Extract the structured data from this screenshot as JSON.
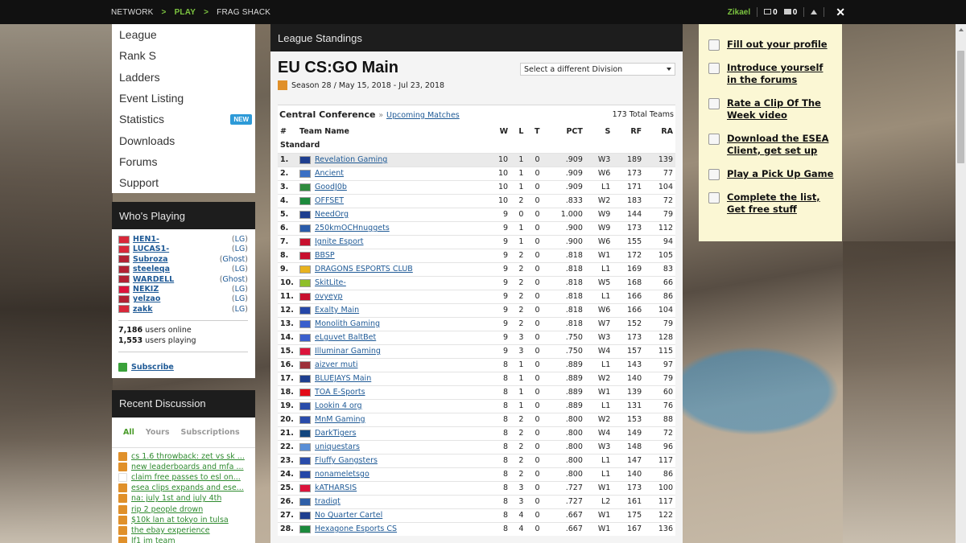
{
  "topbar": {
    "crumbs": [
      "NETWORK",
      "PLAY",
      "FRAG SHACK"
    ],
    "sep": ">",
    "user": "Zikael",
    "mail_count": "0",
    "chat_count": "0",
    "close_symbol": "✕"
  },
  "nav": {
    "items": [
      "League",
      "Rank S",
      "Ladders",
      "Event Listing",
      "Statistics",
      "Downloads",
      "Forums",
      "Support"
    ],
    "new_badge": "NEW"
  },
  "whos_playing": {
    "title": "Who's Playing",
    "players": [
      {
        "name": "HEN1-",
        "game": "LG",
        "flag": "#d8283a"
      },
      {
        "name": "LUCAS1-",
        "game": "LG",
        "flag": "#d8283a"
      },
      {
        "name": "Subroza",
        "game": "Ghost",
        "flag": "#b22234"
      },
      {
        "name": "steeleqa",
        "game": "LG",
        "flag": "#b22234"
      },
      {
        "name": "WARDELL",
        "game": "Ghost",
        "flag": "#b22234"
      },
      {
        "name": "NEKIZ",
        "game": "LG",
        "flag": "#dc143c"
      },
      {
        "name": "yelzao",
        "game": "LG",
        "flag": "#b22234"
      },
      {
        "name": "zakk",
        "game": "LG",
        "flag": "#d8283a"
      }
    ],
    "users_online": "7,186",
    "users_online_label": "users online",
    "users_playing": "1,553",
    "users_playing_label": "users playing",
    "subscribe": "Subscribe"
  },
  "recent": {
    "title": "Recent Discussion",
    "tabs": [
      "All",
      "Yours",
      "Subscriptions"
    ],
    "items": [
      {
        "text": "cs 1.6 throwback: zet vs sk ...",
        "icon": "cs"
      },
      {
        "text": "new leaderboards and mfa ...",
        "icon": "cs"
      },
      {
        "text": "claim free passes to esl on...",
        "icon": "blank"
      },
      {
        "text": "esea clips expands and ese...",
        "icon": "cs"
      },
      {
        "text": "na: july 1st and july 4th",
        "icon": "cs"
      },
      {
        "text": "rip 2 people drown",
        "icon": "cs"
      },
      {
        "text": "$10k lan at tokyo in tulsa",
        "icon": "cs"
      },
      {
        "text": "the ebay experience",
        "icon": "cs"
      },
      {
        "text": "lf1 im team",
        "icon": "cs"
      }
    ]
  },
  "main": {
    "panel_title": "League Standings",
    "title": "EU CS:GO Main",
    "season": "Season 28 / May 15, 2018 - Jul 23, 2018",
    "division_select": "Select a different Division",
    "conference": "Central Conference",
    "raquo": "»",
    "upcoming": "Upcoming Matches",
    "total_teams": "173 Total Teams",
    "columns": [
      "#",
      "Team Name",
      "W",
      "L",
      "T",
      "PCT",
      "S",
      "RF",
      "RA"
    ],
    "group": "Standard",
    "rows": [
      {
        "rk": "1.",
        "team": "Revelation Gaming",
        "w": "10",
        "l": "1",
        "t": "0",
        "pct": ".909",
        "s": "W3",
        "rf": "189",
        "ra": "139",
        "flag": "#1f3f8f"
      },
      {
        "rk": "2.",
        "team": "Ancient",
        "w": "10",
        "l": "1",
        "t": "0",
        "pct": ".909",
        "s": "W6",
        "rf": "173",
        "ra": "77",
        "flag": "#3a6fc4"
      },
      {
        "rk": "3.",
        "team": "GoodJ0b",
        "w": "10",
        "l": "1",
        "t": "0",
        "pct": ".909",
        "s": "L1",
        "rf": "171",
        "ra": "104",
        "flag": "#2e8b3d"
      },
      {
        "rk": "4.",
        "team": "OFFSET",
        "w": "10",
        "l": "2",
        "t": "0",
        "pct": ".833",
        "s": "W2",
        "rf": "183",
        "ra": "72",
        "flag": "#1c8a3c"
      },
      {
        "rk": "5.",
        "team": "NeedOrg",
        "w": "9",
        "l": "0",
        "t": "0",
        "pct": "1.000",
        "s": "W9",
        "rf": "144",
        "ra": "79",
        "flag": "#1f3f8f"
      },
      {
        "rk": "6.",
        "team": "250kmOCHnuggets",
        "w": "9",
        "l": "1",
        "t": "0",
        "pct": ".900",
        "s": "W9",
        "rf": "173",
        "ra": "112",
        "flag": "#2a5caa"
      },
      {
        "rk": "7.",
        "team": "Ignite Esport",
        "w": "9",
        "l": "1",
        "t": "0",
        "pct": ".900",
        "s": "W6",
        "rf": "155",
        "ra": "94",
        "flag": "#c8102e"
      },
      {
        "rk": "8.",
        "team": "BBSP",
        "w": "9",
        "l": "2",
        "t": "0",
        "pct": ".818",
        "s": "W1",
        "rf": "172",
        "ra": "105",
        "flag": "#c8102e"
      },
      {
        "rk": "9.",
        "team": "DRAGONS ESPORTS CLUB",
        "w": "9",
        "l": "2",
        "t": "0",
        "pct": ".818",
        "s": "L1",
        "rf": "169",
        "ra": "83",
        "flag": "#e8b21e"
      },
      {
        "rk": "10.",
        "team": "SkitLite-",
        "w": "9",
        "l": "2",
        "t": "0",
        "pct": ".818",
        "s": "W5",
        "rf": "168",
        "ra": "66",
        "flag": "#8fbf2a"
      },
      {
        "rk": "11.",
        "team": "ovyeyp",
        "w": "9",
        "l": "2",
        "t": "0",
        "pct": ".818",
        "s": "L1",
        "rf": "166",
        "ra": "86",
        "flag": "#c8102e"
      },
      {
        "rk": "12.",
        "team": "Exalty Main",
        "w": "9",
        "l": "2",
        "t": "0",
        "pct": ".818",
        "s": "W6",
        "rf": "166",
        "ra": "104",
        "flag": "#2547a8"
      },
      {
        "rk": "13.",
        "team": "Monolith Gaming",
        "w": "9",
        "l": "2",
        "t": "0",
        "pct": ".818",
        "s": "W7",
        "rf": "152",
        "ra": "79",
        "flag": "#3a5fcd"
      },
      {
        "rk": "14.",
        "team": "eLguvet BaltBet",
        "w": "9",
        "l": "3",
        "t": "0",
        "pct": ".750",
        "s": "W3",
        "rf": "173",
        "ra": "128",
        "flag": "#3a5fcd"
      },
      {
        "rk": "15.",
        "team": "Illuminar Gaming",
        "w": "9",
        "l": "3",
        "t": "0",
        "pct": ".750",
        "s": "W4",
        "rf": "157",
        "ra": "115",
        "flag": "#dc143c"
      },
      {
        "rk": "16.",
        "team": "aizver muti",
        "w": "8",
        "l": "1",
        "t": "0",
        "pct": ".889",
        "s": "L1",
        "rf": "143",
        "ra": "97",
        "flag": "#9e3039"
      },
      {
        "rk": "17.",
        "team": "BLUEJAYS Main",
        "w": "8",
        "l": "1",
        "t": "0",
        "pct": ".889",
        "s": "W2",
        "rf": "140",
        "ra": "79",
        "flag": "#1f3f8f"
      },
      {
        "rk": "18.",
        "team": "TOA E-Sports",
        "w": "8",
        "l": "1",
        "t": "0",
        "pct": ".889",
        "s": "W1",
        "rf": "139",
        "ra": "60",
        "flag": "#e30a17"
      },
      {
        "rk": "19.",
        "team": "Lookin 4 org",
        "w": "8",
        "l": "1",
        "t": "0",
        "pct": ".889",
        "s": "L1",
        "rf": "131",
        "ra": "76",
        "flag": "#2a4caa"
      },
      {
        "rk": "20.",
        "team": "MnM Gaming",
        "w": "8",
        "l": "2",
        "t": "0",
        "pct": ".800",
        "s": "W2",
        "rf": "153",
        "ra": "88",
        "flag": "#2a4caa"
      },
      {
        "rk": "21.",
        "team": "DarkTigers",
        "w": "8",
        "l": "2",
        "t": "0",
        "pct": ".800",
        "s": "W4",
        "rf": "149",
        "ra": "72",
        "flag": "#11457e"
      },
      {
        "rk": "22.",
        "team": "uniquestars",
        "w": "8",
        "l": "2",
        "t": "0",
        "pct": ".800",
        "s": "W3",
        "rf": "148",
        "ra": "96",
        "flag": "#5a8fd6"
      },
      {
        "rk": "23.",
        "team": "Fluffy Gangsters",
        "w": "8",
        "l": "2",
        "t": "0",
        "pct": ".800",
        "s": "L1",
        "rf": "147",
        "ra": "117",
        "flag": "#2a4caa"
      },
      {
        "rk": "24.",
        "team": "nonameletsgo",
        "w": "8",
        "l": "2",
        "t": "0",
        "pct": ".800",
        "s": "L1",
        "rf": "140",
        "ra": "86",
        "flag": "#2547a8"
      },
      {
        "rk": "25.",
        "team": "kATHARSIS",
        "w": "8",
        "l": "3",
        "t": "0",
        "pct": ".727",
        "s": "W1",
        "rf": "173",
        "ra": "100",
        "flag": "#dc143c"
      },
      {
        "rk": "26.",
        "team": "tradiqt",
        "w": "8",
        "l": "3",
        "t": "0",
        "pct": ".727",
        "s": "L2",
        "rf": "161",
        "ra": "117",
        "flag": "#2e5fa8"
      },
      {
        "rk": "27.",
        "team": "No Quarter Cartel",
        "w": "8",
        "l": "4",
        "t": "0",
        "pct": ".667",
        "s": "W1",
        "rf": "175",
        "ra": "122",
        "flag": "#1f3f8f"
      },
      {
        "rk": "28.",
        "team": "Hexagone Esports CS",
        "w": "8",
        "l": "4",
        "t": "0",
        "pct": ".667",
        "s": "W1",
        "rf": "167",
        "ra": "136",
        "flag": "#1c8a3c"
      }
    ]
  },
  "checklist": {
    "items": [
      "Fill out your profile",
      "Introduce yourself in the forums",
      "Rate a Clip Of The Week video",
      "Download the ESEA Client, get set up",
      "Play a Pick Up Game",
      "Complete the list, Get free stuff"
    ]
  },
  "colors": {
    "accent_green": "#7cc440",
    "link_blue": "#1f5a96",
    "new_badge": "#2d9ad8",
    "panel_dark": "#1d1d1d",
    "checklist_bg": "#fbf7d4"
  }
}
